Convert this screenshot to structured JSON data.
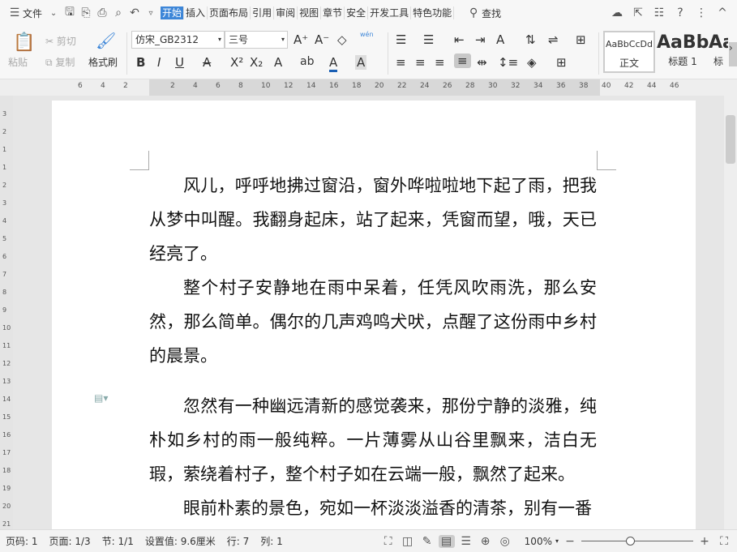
{
  "menu": {
    "file": "文件",
    "tabs": [
      "开始",
      "插入",
      "页面布局",
      "引用",
      "审阅",
      "视图",
      "章节",
      "安全",
      "开发工具",
      "特色功能"
    ],
    "active": "开始",
    "search": "查找"
  },
  "toolbar": {
    "paste": "粘贴",
    "cut": "剪切",
    "copy": "复制",
    "format_painter": "格式刷",
    "font": "仿宋_GB2312",
    "size": "三号",
    "pinyin": "wén",
    "styles": [
      {
        "preview": "AaBbCcDd",
        "label": "正文"
      },
      {
        "preview": "AaBb",
        "label": "标题 1"
      },
      {
        "preview": "Aa",
        "label": "标"
      }
    ]
  },
  "ruler": {
    "ticks": [
      "6",
      "4",
      "2",
      "2",
      "4",
      "6",
      "8",
      "10",
      "12",
      "14",
      "16",
      "18",
      "20",
      "22",
      "24",
      "26",
      "28",
      "30",
      "32",
      "34",
      "36",
      "38",
      "40",
      "42",
      "44",
      "46"
    ]
  },
  "vruler": {
    "ticks": [
      "3",
      "2",
      "1",
      "1",
      "2",
      "3",
      "4",
      "5",
      "6",
      "7",
      "8",
      "9",
      "10",
      "11",
      "12",
      "13",
      "14",
      "15",
      "16",
      "17",
      "18",
      "19",
      "20",
      "21"
    ]
  },
  "document": {
    "paragraphs": [
      "风儿，呼呼地拂过窗沿，窗外哗啦啦地下起了雨，把我从梦中叫醒。我翻身起床，站了起来，凭窗而望，哦，天已经亮了。",
      "整个村子安静地在雨中呆着，任凭风吹雨洗，那么安然，那么简单。偶尔的几声鸡鸣犬吠，点醒了这份雨中乡村的晨景。",
      "忽然有一种幽远清新的感觉袭来，那份宁静的淡雅，纯朴如乡村的雨一般纯粹。一片薄雾从山谷里飘来，洁白无瑕，萦绕着村子，整个村子如在云端一般，飘然了起来。",
      "眼前朴素的景色，宛如一杯淡淡溢香的清茶，别有一番"
    ]
  },
  "status": {
    "page_no": "页码: 1",
    "pages": "页面: 1/3",
    "section": "节: 1/1",
    "setting": "设置值: 9.6厘米",
    "row": "行: 7",
    "col": "列: 1",
    "zoom": "100%",
    "zoom_percent": 100
  }
}
